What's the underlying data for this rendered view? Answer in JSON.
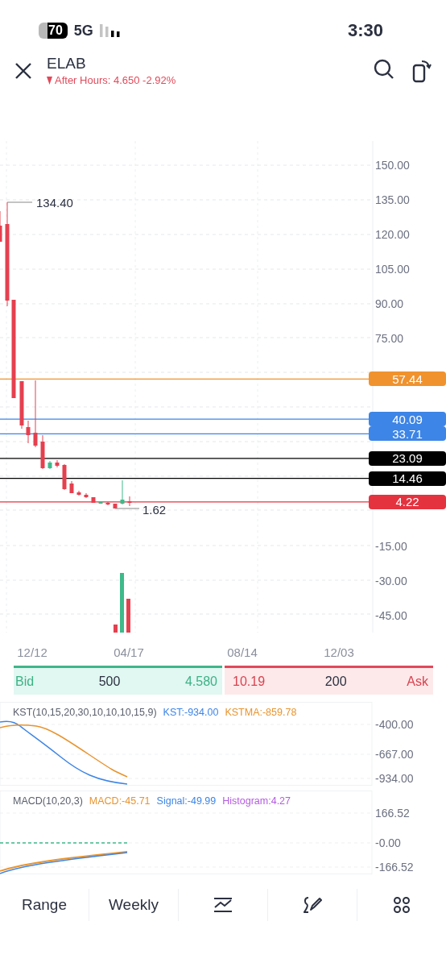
{
  "status_bar": {
    "battery": "70",
    "network": "5G",
    "time": "3:30"
  },
  "header": {
    "symbol": "ELAB",
    "after_hours": "After Hours: 4.650 -2.92%"
  },
  "chart": {
    "y_ticks": [
      "150.00",
      "135.00",
      "120.00",
      "105.00",
      "90.00",
      "75.00",
      "-15.00",
      "-30.00",
      "-45.00"
    ],
    "price_lines": [
      {
        "value": "57.44",
        "color": "#f0922e"
      },
      {
        "value": "40.09",
        "color": "#3d85e6"
      },
      {
        "value": "33.71",
        "color": "#3d85e6"
      },
      {
        "value": "23.09",
        "color": "#000000"
      },
      {
        "value": "14.46",
        "color": "#000000"
      },
      {
        "value": "4.22",
        "color": "#e5323f"
      }
    ],
    "high_label": "134.40",
    "low_label": "1.62",
    "x_labels": [
      "12/12",
      "04/17",
      "08/14",
      "12/03"
    ]
  },
  "order_book": {
    "bid_label": "Bid",
    "bid_size": "500",
    "bid_price": "4.580",
    "ask_price": "10.19",
    "ask_size": "200",
    "ask_label": "Ask"
  },
  "indicators": [
    {
      "name": "KST(10,15,20,30,10,10,10,15,9)",
      "values": [
        {
          "text": "KST:-934.00",
          "color": "#3d85e6"
        },
        {
          "text": "KSTMA:-859.78",
          "color": "#e8942e"
        }
      ],
      "y_ticks": [
        "-400.00",
        "-667.00",
        "-934.00"
      ]
    },
    {
      "name": "MACD(10,20,3)",
      "values": [
        {
          "text": "MACD:-45.71",
          "color": "#e8942e"
        },
        {
          "text": "Signal:-49.99",
          "color": "#3d85e6"
        },
        {
          "text": "Histogram:4.27",
          "color": "#b45be0"
        }
      ],
      "y_ticks": [
        "166.52",
        "-0.00",
        "-166.52"
      ]
    }
  ],
  "toolbar": [
    {
      "kind": "text",
      "label": "Range"
    },
    {
      "kind": "text",
      "label": "Weekly"
    },
    {
      "kind": "indicators"
    },
    {
      "kind": "drawing"
    },
    {
      "kind": "more"
    }
  ]
}
